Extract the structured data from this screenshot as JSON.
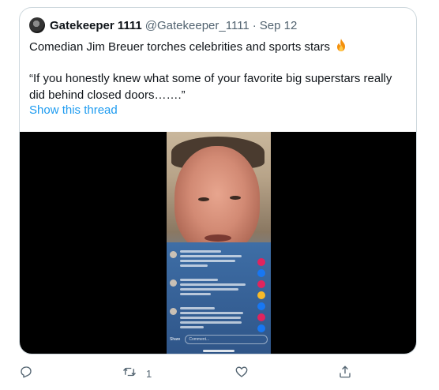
{
  "tweet": {
    "display_name": "Gatekeeper 1111",
    "handle": "@Gatekeeper_1111",
    "separator": "·",
    "date": "Sep 12",
    "line1": "Comedian Jim Breuer torches celebrities and sports stars",
    "line2": "“If you honestly knew what some of your favorite big superstars really",
    "line3": "did behind closed doors…….”",
    "show_thread": "Show this thread",
    "media": {
      "share_label": "Share",
      "comment_placeholder": "Comment..."
    }
  },
  "actions": {
    "retweet_count": "1"
  },
  "colors": {
    "link": "#1d9bf0",
    "secondary_text": "#536471",
    "border": "#cfd9de"
  },
  "icons": [
    "fire-emoji",
    "reply-icon",
    "retweet-icon",
    "like-icon",
    "share-icon"
  ]
}
